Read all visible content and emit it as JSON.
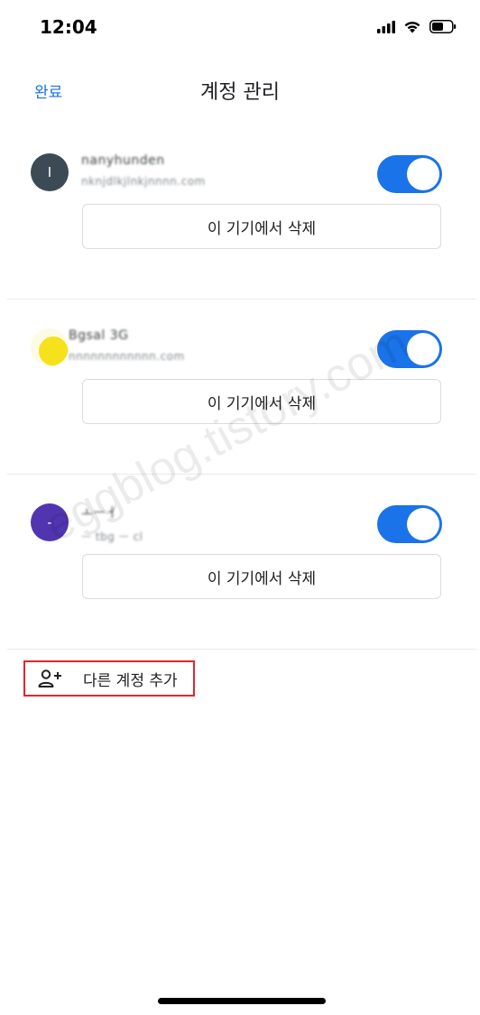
{
  "status_bar": {
    "time": "12:04",
    "icons": [
      "cellular-signal-icon",
      "wifi-icon",
      "battery-icon"
    ]
  },
  "nav": {
    "done_label": "완료",
    "title": "계정 관리"
  },
  "accounts": [
    {
      "name": "nanyhunden",
      "email": "nknjdlkjlnkjnnnn.com",
      "avatar_letter": "I",
      "avatar_color": "#3c4a55",
      "sync_on": true,
      "remove_label": "이 기기에서 삭제"
    },
    {
      "name": "Bgsal 3G",
      "email": "nnnnnnnnnnnn.com",
      "avatar_letter": "",
      "avatar_color": "#f6e21c",
      "sync_on": true,
      "remove_label": "이 기기에서 삭제"
    },
    {
      "name": "ㅗㅡㅓ",
      "email": "ㅡ tbg ㅡ cl",
      "avatar_letter": "-",
      "avatar_color": "#5135b0",
      "sync_on": true,
      "remove_label": "이 기기에서 삭제"
    }
  ],
  "add_account": {
    "label": "다른 계정 추가",
    "icon": "add-person-icon"
  },
  "watermark": "eggblog.tistory.com",
  "colors": {
    "accent": "#1a73e8",
    "highlight_box": "#e0262f"
  }
}
